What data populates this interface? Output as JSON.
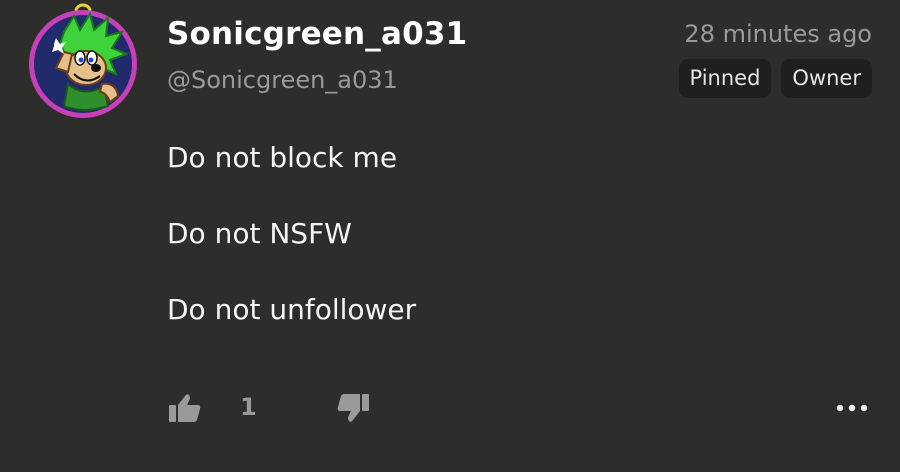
{
  "author": {
    "display_name": "Sonicgreen_a031",
    "handle": "@Sonicgreen_a031"
  },
  "timestamp": "28 minutes ago",
  "badges": [
    "Pinned",
    "Owner"
  ],
  "body_lines": [
    "Do not block me",
    "Do not NSFW",
    "Do not unfollower"
  ],
  "actions": {
    "like_count": "1"
  },
  "colors": {
    "background": "#2d2d2b",
    "badge_bg": "#1f1f1e",
    "muted_text": "#9a9a96",
    "avatar_ring": "#c640b8",
    "avatar_green": "#3fd23a"
  }
}
